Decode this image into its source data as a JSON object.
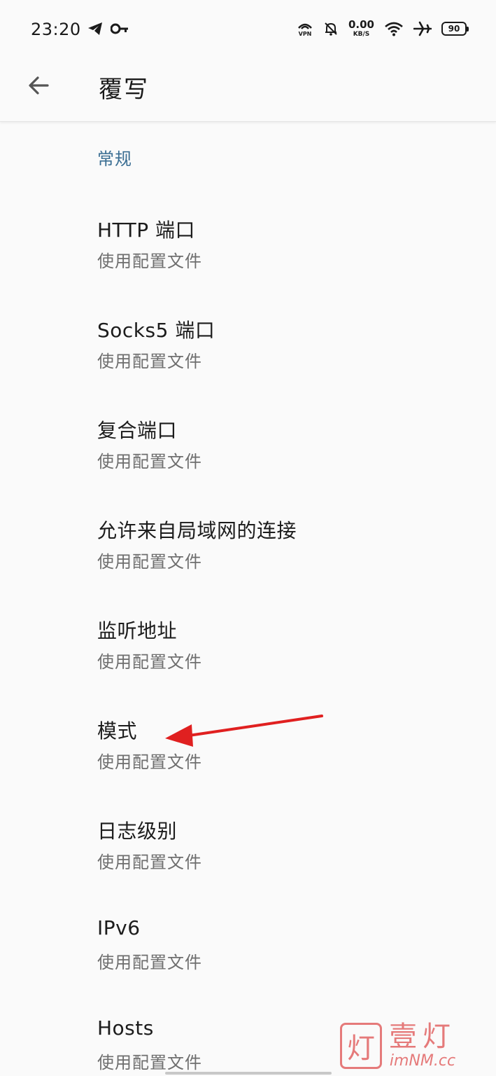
{
  "status_bar": {
    "time": "23:20",
    "speed_value": "0.00",
    "speed_unit": "KB/S",
    "battery": "90"
  },
  "app_bar": {
    "title": "覆写"
  },
  "section": {
    "header": "常规"
  },
  "items": [
    {
      "title": "HTTP 端口",
      "subtitle": "使用配置文件"
    },
    {
      "title": "Socks5 端口",
      "subtitle": "使用配置文件"
    },
    {
      "title": "复合端口",
      "subtitle": "使用配置文件"
    },
    {
      "title": "允许来自局域网的连接",
      "subtitle": "使用配置文件"
    },
    {
      "title": "监听地址",
      "subtitle": "使用配置文件"
    },
    {
      "title": "模式",
      "subtitle": "使用配置文件"
    },
    {
      "title": "日志级别",
      "subtitle": "使用配置文件"
    },
    {
      "title": "IPv6",
      "subtitle": "使用配置文件"
    },
    {
      "title": "Hosts",
      "subtitle": "使用配置文件"
    }
  ],
  "watermark": {
    "logo_char": "灯",
    "name": "壹灯",
    "domain": "imNM.cc"
  },
  "colors": {
    "accent": "#3a6e93",
    "annotation_arrow": "#e02020",
    "watermark": "#e57a7a"
  }
}
